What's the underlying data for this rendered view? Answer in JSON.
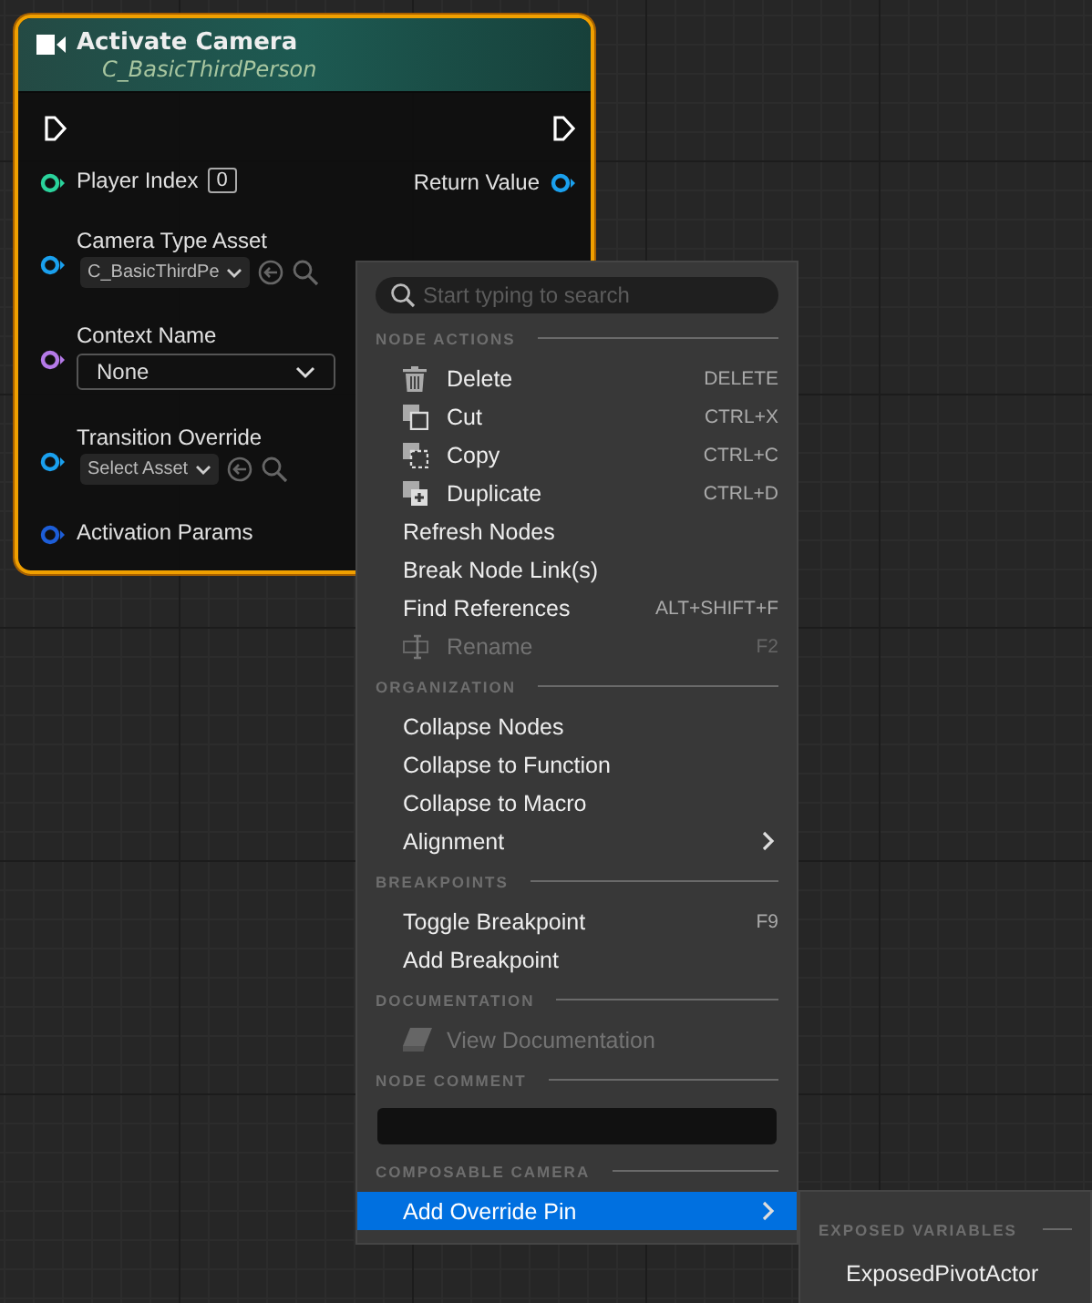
{
  "node": {
    "title": "Activate Camera",
    "subtitle": "C_BasicThirdPerson",
    "selected": true,
    "inputs": [
      {
        "label": "Player Index",
        "color": "#2ad39c",
        "kind": "number",
        "value": "0"
      },
      {
        "label": "Camera Type Asset",
        "color": "#1aa0ee",
        "kind": "asset",
        "value": "C_BasicThirdPe"
      },
      {
        "label": "Context Name",
        "color": "#b57ae8",
        "kind": "dropdown",
        "value": "None"
      },
      {
        "label": "Transition Override",
        "color": "#1aa0ee",
        "kind": "asset",
        "value": "Select Asset"
      },
      {
        "label": "Activation Params",
        "color": "#1d5ed8",
        "kind": "plain"
      }
    ],
    "outputs": [
      {
        "label": "Return Value",
        "color": "#1aa0ee"
      }
    ]
  },
  "context_menu": {
    "search": {
      "placeholder": "Start typing to search"
    },
    "sections": [
      {
        "title": "NODE ACTIONS",
        "kind": "items",
        "items": [
          {
            "label": "Delete",
            "shortcut": "DELETE",
            "kind": "trash",
            "disabled": false,
            "selected": false
          },
          {
            "label": "Cut",
            "shortcut": "CTRL+X",
            "kind": "cut",
            "disabled": false,
            "selected": false
          },
          {
            "label": "Copy",
            "shortcut": "CTRL+C",
            "kind": "copy",
            "disabled": false,
            "selected": false
          },
          {
            "label": "Duplicate",
            "shortcut": "CTRL+D",
            "kind": "duplicate",
            "disabled": false,
            "selected": false
          },
          {
            "label": "Refresh Nodes",
            "disabled": false,
            "selected": false
          },
          {
            "label": "Break Node Link(s)",
            "disabled": false,
            "selected": false
          },
          {
            "label": "Find References",
            "shortcut": "ALT+SHIFT+F",
            "disabled": false,
            "selected": false
          },
          {
            "label": "Rename",
            "shortcut": "F2",
            "kind": "rename",
            "disabled": true,
            "selected": false
          }
        ]
      },
      {
        "title": "ORGANIZATION",
        "kind": "items",
        "items": [
          {
            "label": "Collapse Nodes",
            "disabled": false,
            "selected": false
          },
          {
            "label": "Collapse to Function",
            "disabled": false,
            "selected": false
          },
          {
            "label": "Collapse to Macro",
            "disabled": false,
            "selected": false
          },
          {
            "label": "Alignment",
            "submenu": true,
            "disabled": false,
            "selected": false
          }
        ]
      },
      {
        "title": "BREAKPOINTS",
        "kind": "items",
        "items": [
          {
            "label": "Toggle Breakpoint",
            "shortcut": "F9",
            "disabled": false,
            "selected": false
          },
          {
            "label": "Add Breakpoint",
            "disabled": false,
            "selected": false
          }
        ]
      },
      {
        "title": "DOCUMENTATION",
        "kind": "items",
        "items": [
          {
            "label": "View Documentation",
            "kind": "book",
            "disabled": true,
            "selected": false
          }
        ]
      },
      {
        "title": "NODE COMMENT",
        "kind": "comment"
      },
      {
        "title": "COMPOSABLE CAMERA",
        "kind": "items",
        "items": [
          {
            "label": "Add Override Pin",
            "submenu": true,
            "disabled": false,
            "selected": true
          }
        ]
      }
    ]
  },
  "submenu": {
    "title": "EXPOSED VARIABLES",
    "items": [
      "ExposedPivotActor"
    ]
  }
}
